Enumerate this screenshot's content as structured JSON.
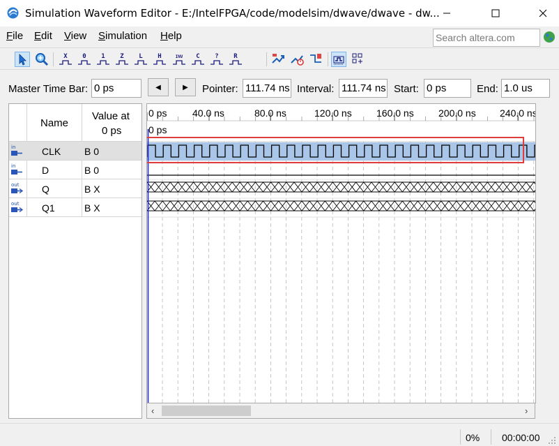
{
  "window": {
    "title": "Simulation Waveform Editor - E:/IntelFPGA/code/modelsim/dwave/dwave - dw...",
    "controls": [
      "minimize-icon",
      "maximize-icon",
      "close-icon"
    ]
  },
  "menu": {
    "items": [
      {
        "label": "File",
        "mnemonic": "F"
      },
      {
        "label": "Edit",
        "mnemonic": "E"
      },
      {
        "label": "View",
        "mnemonic": "V"
      },
      {
        "label": "Simulation",
        "mnemonic": "S"
      },
      {
        "label": "Help",
        "mnemonic": "H"
      }
    ],
    "search_placeholder": "Search altera.com"
  },
  "toolbar": {
    "buttons": [
      {
        "name": "selection-tool-icon",
        "text": ""
      },
      {
        "name": "zoom-tool-icon",
        "text": ""
      },
      {
        "name": "forcing-unknown-icon",
        "text": "X"
      },
      {
        "name": "forcing-low-icon",
        "text": "0"
      },
      {
        "name": "forcing-high-icon",
        "text": "1"
      },
      {
        "name": "high-impedance-icon",
        "text": "Z"
      },
      {
        "name": "weak-low-icon",
        "text": "L"
      },
      {
        "name": "weak-high-icon",
        "text": "H"
      },
      {
        "name": "invert-icon",
        "text": "INV"
      },
      {
        "name": "count-value-icon",
        "text": "C"
      },
      {
        "name": "overwrite-clock-icon",
        "text": "?"
      },
      {
        "name": "random-values-icon",
        "text": "R"
      },
      {
        "name": "run-functional-simulation-icon",
        "text": ""
      },
      {
        "name": "run-timing-simulation-icon",
        "text": ""
      },
      {
        "name": "generate-netlist-icon",
        "text": ""
      },
      {
        "name": "snap-to-grid-icon",
        "text": ""
      },
      {
        "name": "arrange-group-icon",
        "text": ""
      }
    ]
  },
  "timebar": {
    "master_time_bar_label": "Master Time Bar:",
    "master_time_bar_value": "0 ps",
    "prev_label": "◀",
    "next_label": "▶",
    "pointer_label": "Pointer:",
    "pointer_value": "111.74 ns",
    "interval_label": "Interval:",
    "interval_value": "111.74 ns",
    "start_label": "Start:",
    "start_value": "0 ps",
    "end_label": "End:",
    "end_value": "1.0 us"
  },
  "signals": {
    "header_name": "Name",
    "header_value_line1": "Value at",
    "header_value_line2": "0 ps",
    "rows": [
      {
        "direction": "in",
        "name": "CLK",
        "value": "B 0",
        "selected": true
      },
      {
        "direction": "in",
        "name": "D",
        "value": "B 0",
        "selected": false
      },
      {
        "direction": "out",
        "name": "Q",
        "value": "B X",
        "selected": false
      },
      {
        "direction": "out",
        "name": "Q1",
        "value": "B X",
        "selected": false
      }
    ]
  },
  "waveform": {
    "ruler_labels": [
      "0 ps",
      "40.0 ns",
      "80.0 ns",
      "120.0 ns",
      "160.0 ns",
      "200.0 ns",
      "240.0 ns"
    ],
    "cursor_label": "0 ps",
    "clock_cycles": 25,
    "highlight_color": "#a9c6e8",
    "selection_box_color": "#e03c3c"
  },
  "status": {
    "progress": "0%",
    "elapsed": "00:00:00"
  }
}
